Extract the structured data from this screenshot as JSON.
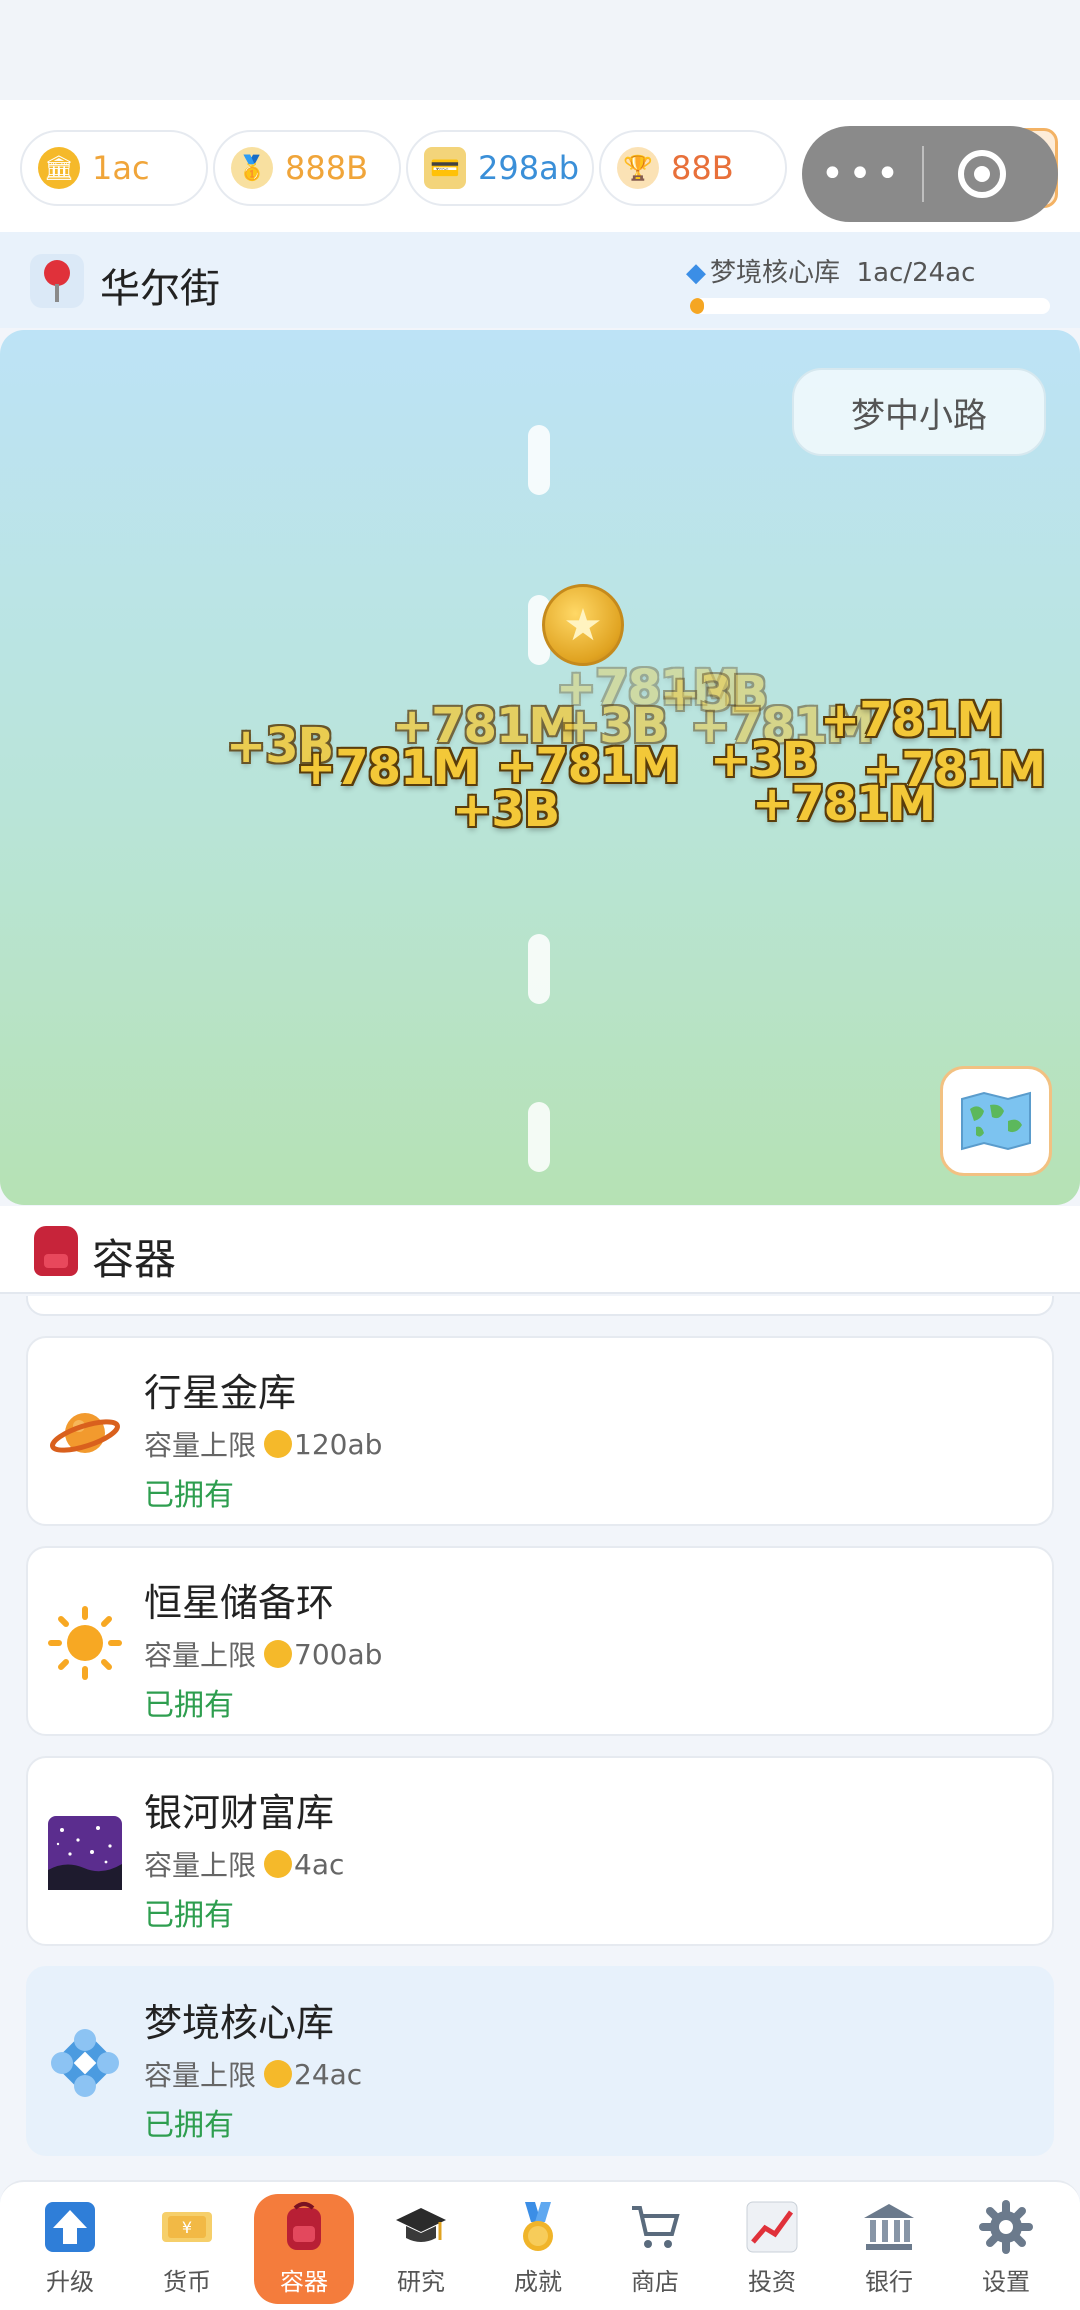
{
  "currencies": [
    {
      "value": "1ac",
      "color": "#f0a53a",
      "icon": "bank-coin-icon"
    },
    {
      "value": "888B",
      "color": "#f0a53a",
      "icon": "medal-icon"
    },
    {
      "value": "298ab",
      "color": "#3a8fd8",
      "icon": "credit-card-icon"
    },
    {
      "value": "88B",
      "color": "#e8703a",
      "icon": "trophy-icon"
    }
  ],
  "menu": {
    "dots": "•••"
  },
  "location": {
    "name": "华尔街",
    "vault_label": "梦境核心库",
    "vault_capacity": "1ac/24ac",
    "vault_progress": 0.04
  },
  "scene": {
    "path_button": "梦中小路",
    "floating_texts": [
      "+781M",
      "+3B",
      "+781M",
      "+3B",
      "+781M",
      "+781M",
      "+3B",
      "+781M",
      "+781M",
      "+3B",
      "+781M",
      "+3B",
      "+781M"
    ]
  },
  "containers": {
    "title": "容器",
    "capacity_label": "容量上限",
    "items": [
      {
        "name": "行星金库",
        "capacity": "120ab",
        "status": "已拥有",
        "icon": "planet-icon"
      },
      {
        "name": "恒星储备环",
        "capacity": "700ab",
        "status": "已拥有",
        "icon": "sun-icon"
      },
      {
        "name": "银河财富库",
        "capacity": "4ac",
        "status": "已拥有",
        "icon": "galaxy-icon"
      },
      {
        "name": "梦境核心库",
        "capacity": "24ac",
        "status": "已拥有",
        "icon": "dream-core-icon"
      }
    ]
  },
  "nav": [
    {
      "label": "升级",
      "icon": "upgrade-arrow-icon"
    },
    {
      "label": "货币",
      "icon": "money-icon"
    },
    {
      "label": "容器",
      "icon": "backpack-icon",
      "active": true
    },
    {
      "label": "研究",
      "icon": "graduation-cap-icon"
    },
    {
      "label": "成就",
      "icon": "medal-icon"
    },
    {
      "label": "商店",
      "icon": "cart-icon"
    },
    {
      "label": "投资",
      "icon": "chart-up-icon"
    },
    {
      "label": "银行",
      "icon": "bank-icon"
    },
    {
      "label": "设置",
      "icon": "gear-icon"
    }
  ]
}
